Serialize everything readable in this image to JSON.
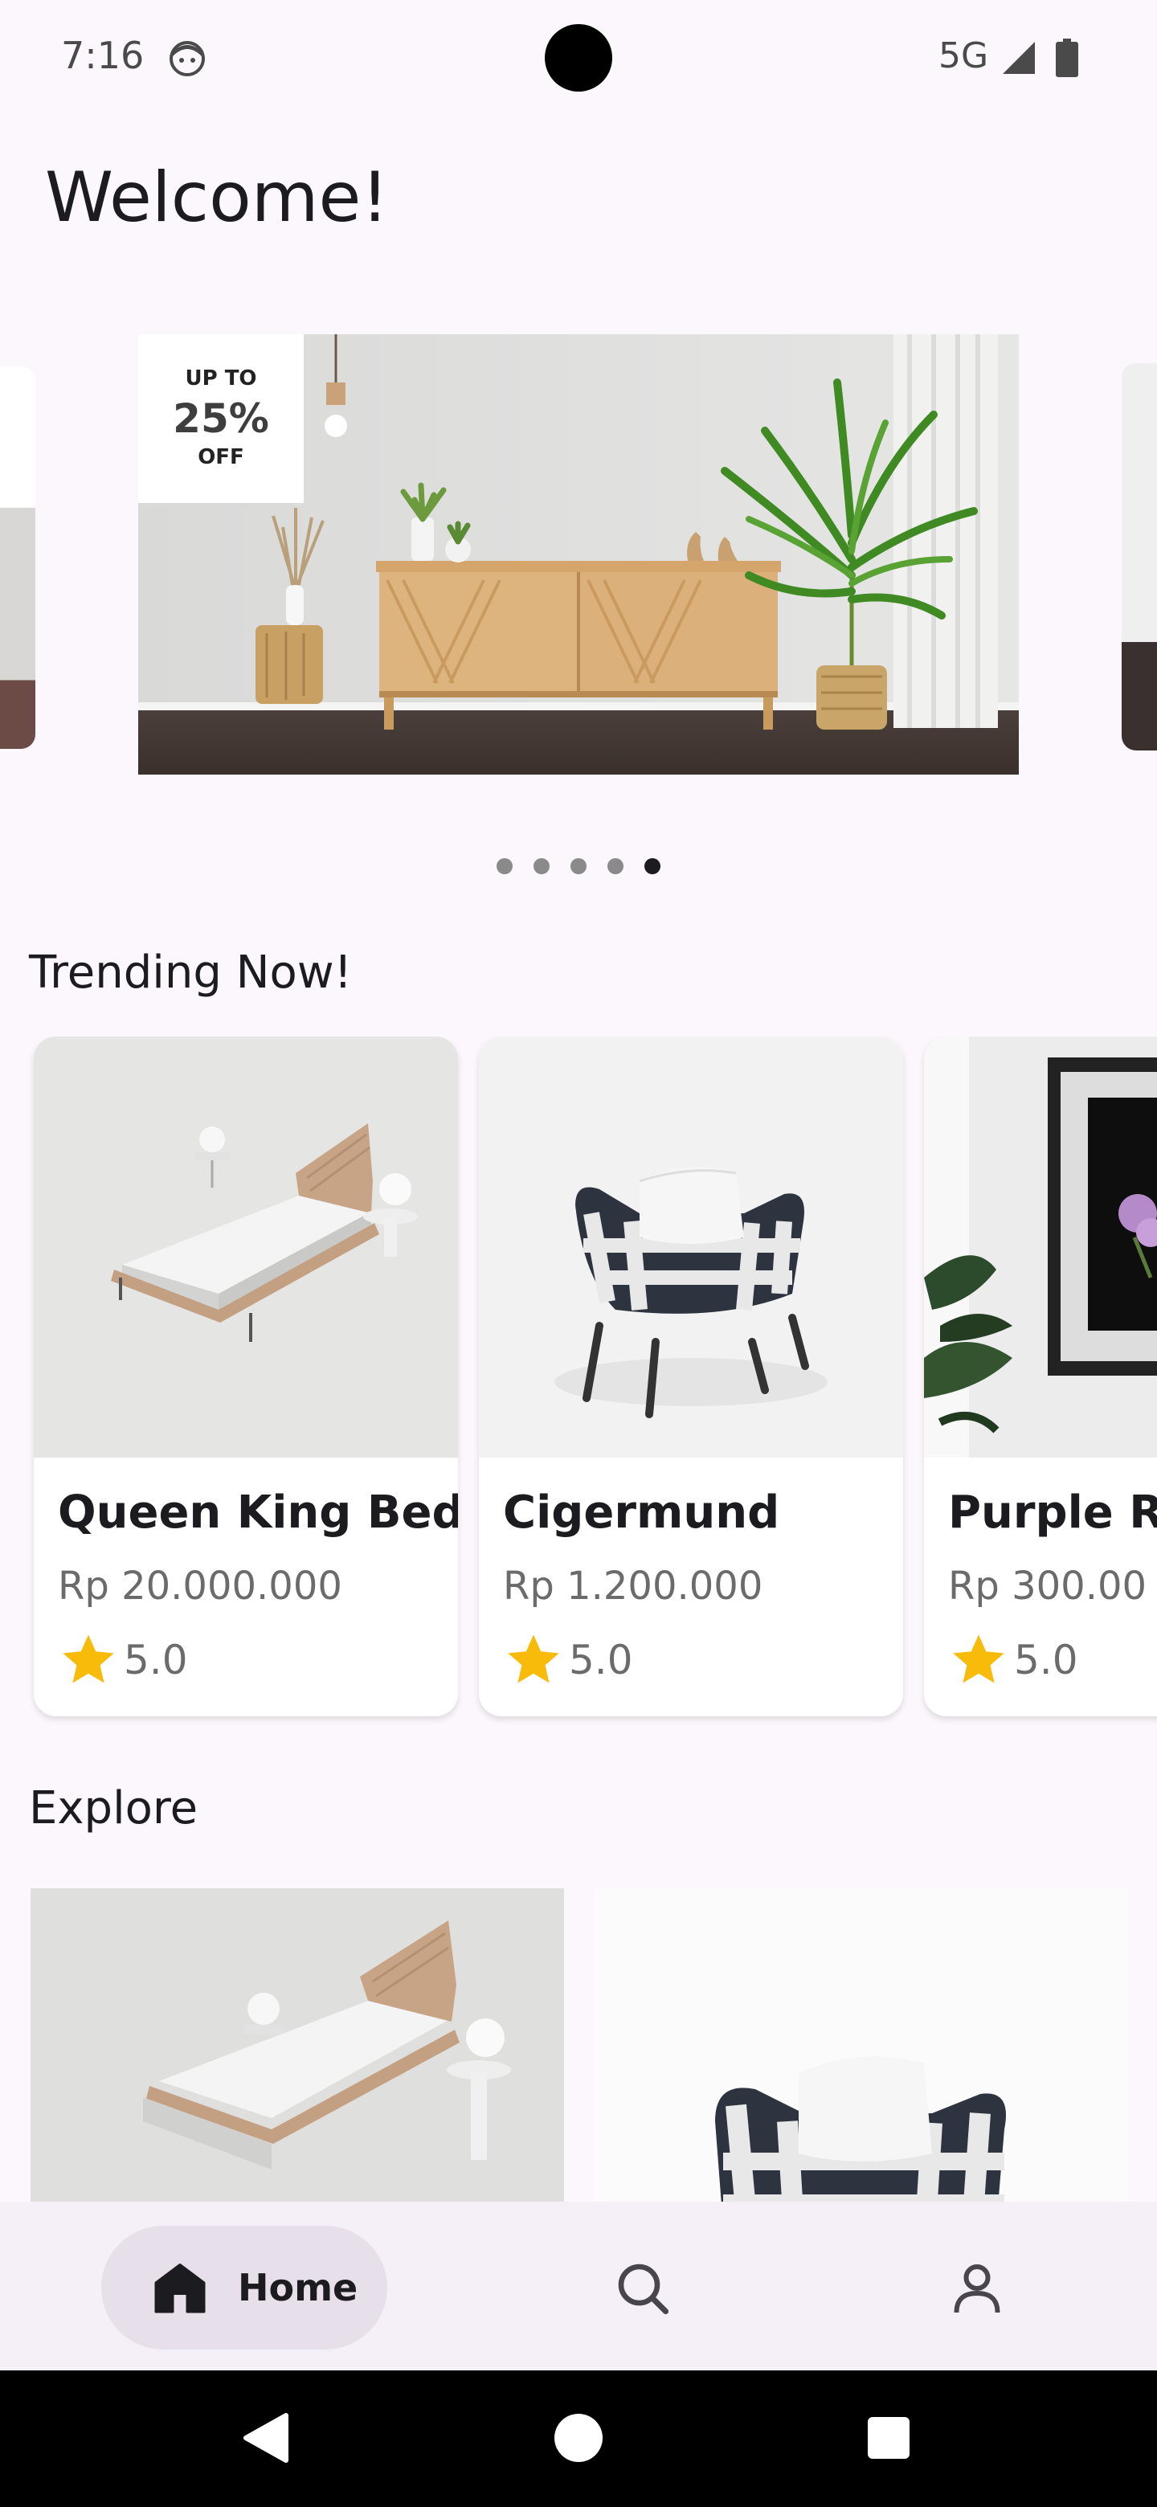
{
  "status_bar": {
    "time": "7:16",
    "network": "5G"
  },
  "header": {
    "title": "Welcome!"
  },
  "banner": {
    "badge_top": "UP TO",
    "badge_percent": "25%",
    "badge_bottom": "OFF",
    "slide_count": 5,
    "active_slide": 5
  },
  "trending": {
    "title": "Trending Now!",
    "items": [
      {
        "name": "Queen King Bed",
        "price": "Rp 20.000.000",
        "rating": "5.0"
      },
      {
        "name": "Cigermund",
        "price": "Rp 1.200.000",
        "rating": "5.0"
      },
      {
        "name": "Purple Ro",
        "price": "Rp 300.00",
        "rating": "5.0"
      }
    ]
  },
  "explore": {
    "title": "Explore"
  },
  "bottom_nav": {
    "home_label": "Home",
    "icons": [
      "home-icon",
      "search-icon",
      "profile-icon"
    ]
  },
  "colors": {
    "background": "#fcf7fc",
    "nav_background": "#f5eff7",
    "nav_active_pill": "#e7e0eb",
    "star": "#f9bb0a"
  }
}
